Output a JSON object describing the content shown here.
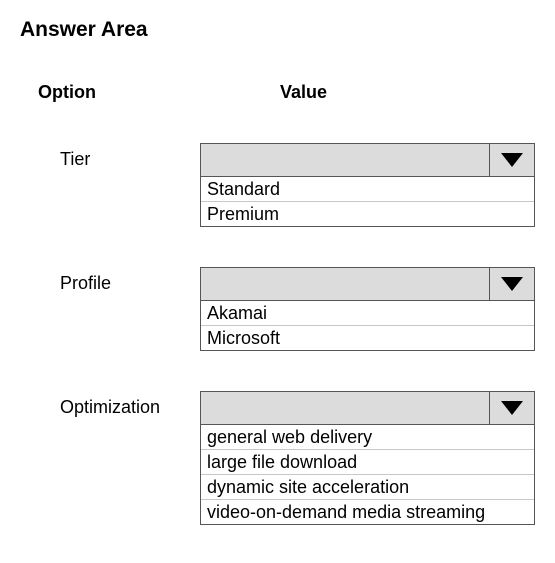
{
  "title": "Answer Area",
  "headers": {
    "option": "Option",
    "value": "Value"
  },
  "rows": [
    {
      "label": "Tier",
      "options": [
        "Standard",
        "Premium"
      ]
    },
    {
      "label": "Profile",
      "options": [
        "Akamai",
        "Microsoft"
      ]
    },
    {
      "label": "Optimization",
      "options": [
        "general web delivery",
        "large file download",
        "dynamic site acceleration",
        "video-on-demand media streaming"
      ]
    }
  ]
}
